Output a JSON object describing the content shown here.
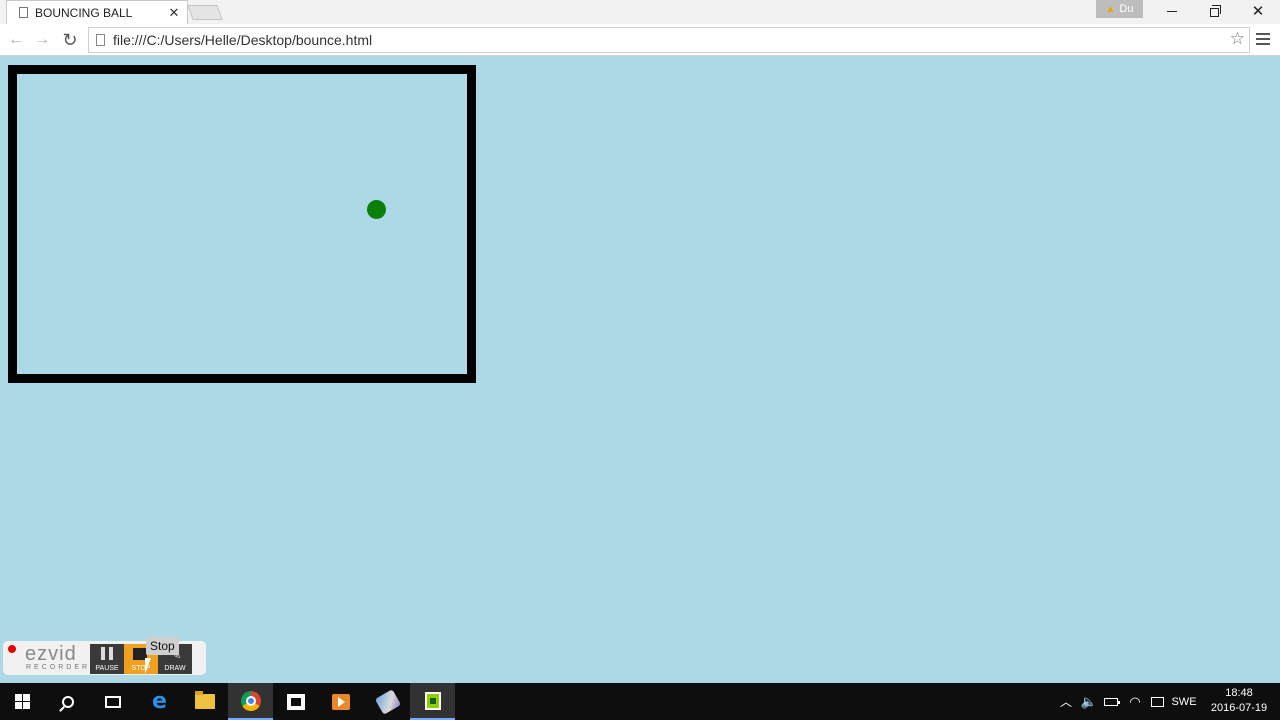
{
  "browser": {
    "tab_title": "BOUNCING BALL",
    "tab_close_glyph": "✕",
    "profile_label": "Du",
    "url": "file:///C:/Users/Helle/Desktop/bounce.html"
  },
  "icons": {
    "back": "arrow-left-icon",
    "forward": "arrow-right-icon",
    "reload": "reload-icon",
    "star": "star-icon",
    "menu": "hamburger-menu-icon",
    "page": "page-icon",
    "warning": "warning-icon"
  },
  "page": {
    "background_color": "#add8e6",
    "canvas_border_color": "#000000",
    "ball_color": "#0a800a"
  },
  "ezvid": {
    "logo": "ezvid",
    "subtitle": "RECORDER",
    "pause_label": "PAUSE",
    "stop_label": "STOP",
    "draw_label": "DRAW",
    "tooltip": "Stop"
  },
  "taskbar": {
    "language": "SWE",
    "time": "18:48",
    "date": "2016-07-19"
  }
}
